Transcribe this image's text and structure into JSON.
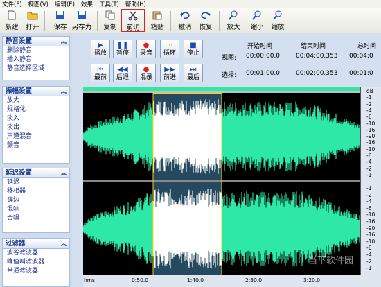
{
  "menu": [
    "文件(F)",
    "视图(V)",
    "编辑(E)",
    "效果",
    "工具(T)",
    "帮助(H)"
  ],
  "toolbar": {
    "new": "新建",
    "open": "打开",
    "save": "保存",
    "save_as": "另存为",
    "copy": "复制",
    "cut": "剪切",
    "paste": "粘贴",
    "undo": "撤消",
    "redo": "恢复",
    "zoom_in": "放大",
    "zoom_out": "缩小",
    "zoom": "缩放"
  },
  "sidebar": {
    "silence": {
      "title": "静音设置",
      "items": [
        "删除静音",
        "插入静音",
        "静音选择区域"
      ]
    },
    "amplitude": {
      "title": "振幅设置",
      "items": [
        "放大",
        "规格化",
        "淡入",
        "淡出",
        "声道混音",
        "颤音"
      ]
    },
    "delay": {
      "title": "延迟设置",
      "items": [
        "延迟",
        "移相器",
        "镶边",
        "混响",
        "合唱"
      ]
    },
    "filter": {
      "title": "过滤器",
      "items": [
        "波谷滤波器",
        "峰值叫滤波器",
        "带通滤波器"
      ]
    }
  },
  "transport": {
    "row1": [
      "播放",
      "暂停",
      "录音",
      "循环",
      "停止"
    ],
    "row2": [
      "最前",
      "后退",
      "混录",
      "前进",
      "最后"
    ]
  },
  "info": {
    "col_start": "开始时间",
    "col_end": "结束时间",
    "col_total": "总时间",
    "view_label": "视图:",
    "view_start": "00:00:00.0",
    "view_end": "00:04:00.353",
    "view_total": "00:04:0",
    "sel_label": "选择:",
    "sel_start": "00:01:00.0",
    "sel_end": "00:02:00.353",
    "sel_total": "00:01:0"
  },
  "ruler": {
    "top": [
      "dB",
      "-1",
      "-2",
      "-4",
      "-6",
      "-10",
      "-16",
      "-90",
      "-16",
      "-10",
      "-6",
      "-4",
      "-2",
      "-1"
    ],
    "bottom": [
      "-1",
      "-2",
      "-4",
      "-6",
      "-10",
      "-16",
      "-90",
      "-16",
      "-10",
      "-6",
      "-4",
      "-2",
      "-1"
    ]
  },
  "timeline": [
    "hms",
    "0:50.0",
    "1:40.0",
    "2:30.0",
    "3:20.0"
  ],
  "watermark": "当下软件园",
  "colors": {
    "wave": "#2ee8a8",
    "selection_bg": "#25495e",
    "selection_wave": "#ffffff",
    "cut_highlight": "#e02020"
  }
}
